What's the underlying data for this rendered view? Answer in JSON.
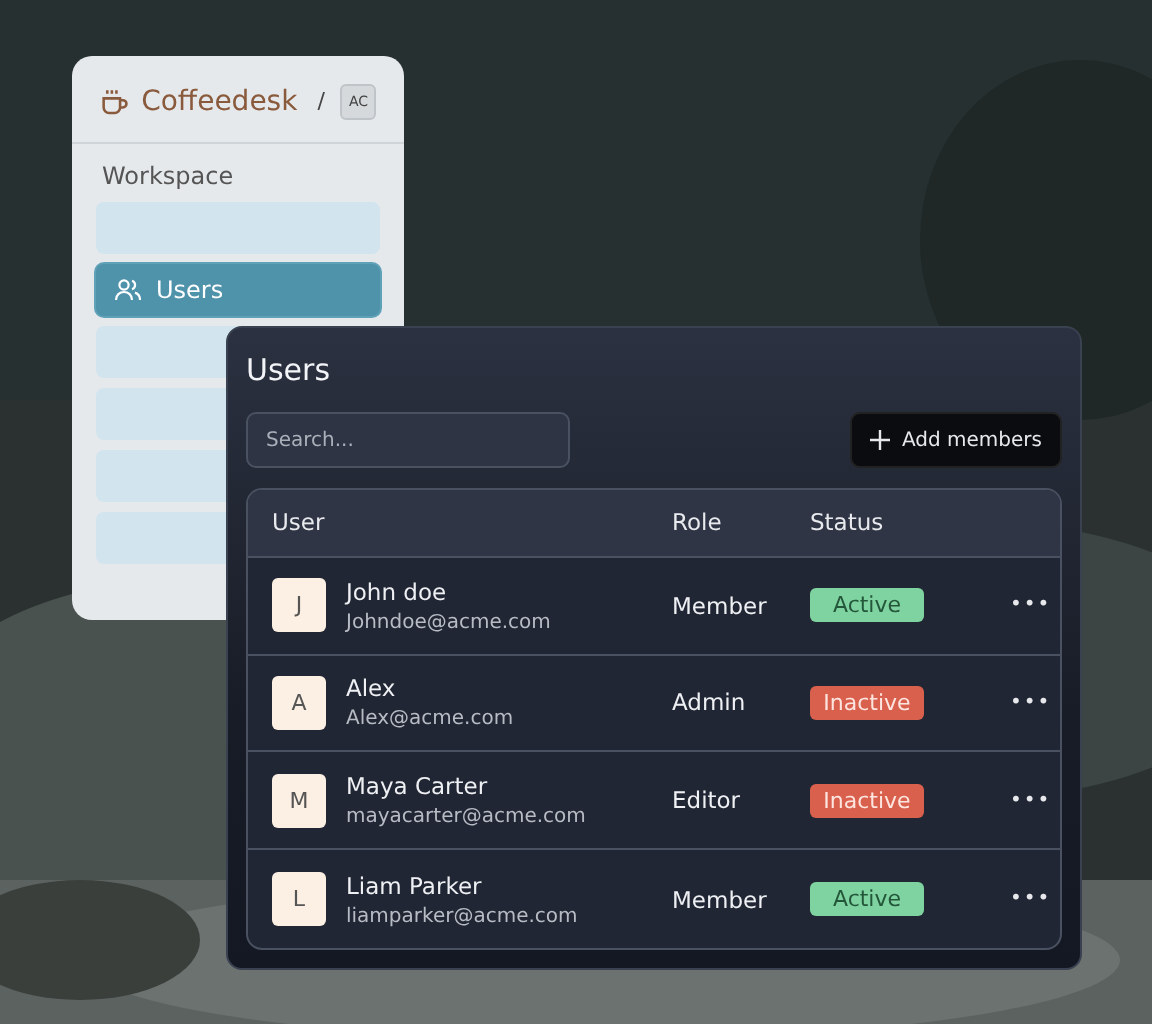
{
  "sidebar": {
    "brand": "Coffeedesk",
    "separator": "/",
    "workspace_badge": "AC",
    "section": "Workspace",
    "items": [
      {
        "selected": false
      },
      {
        "label": "Users",
        "selected": true
      },
      {
        "selected": false
      },
      {
        "selected": false
      },
      {
        "selected": false
      },
      {
        "selected": false
      }
    ]
  },
  "panel": {
    "title": "Users",
    "search": {
      "placeholder": "Search..."
    },
    "add_button": "Add members",
    "table": {
      "columns": [
        "User",
        "Role",
        "Status"
      ],
      "rows": [
        {
          "initial": "J",
          "name": "John doe",
          "email": "Johndoe@acme.com",
          "role": "Member",
          "status": {
            "label": "Active",
            "kind": "active"
          },
          "menu": "•••"
        },
        {
          "initial": "A",
          "name": "Alex",
          "email": "Alex@acme.com",
          "role": "Admin",
          "status": {
            "label": "Inactive",
            "kind": "inactive"
          },
          "menu": "•••"
        },
        {
          "initial": "M",
          "name": "Maya Carter",
          "email": "mayacarter@acme.com",
          "role": "Editor",
          "status": {
            "label": "Inactive",
            "kind": "inactive"
          },
          "menu": "•••"
        },
        {
          "initial": "L",
          "name": "Liam Parker",
          "email": "liamparker@acme.com",
          "role": "Member",
          "status": {
            "label": "Active",
            "kind": "active"
          },
          "menu": "•••"
        }
      ]
    }
  }
}
